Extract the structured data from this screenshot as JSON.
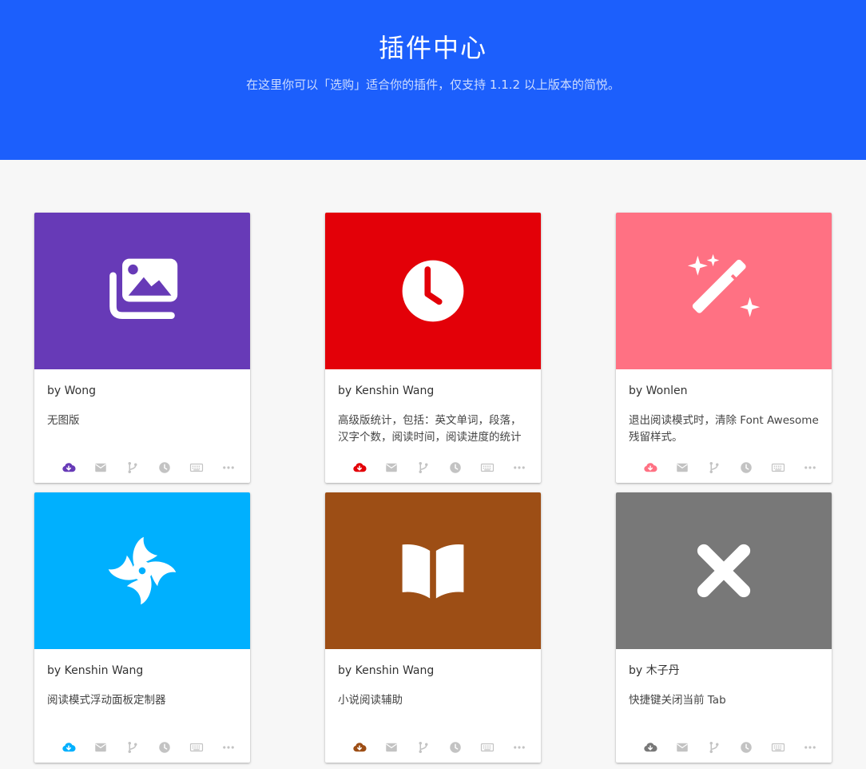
{
  "header": {
    "title": "插件中心",
    "subtitle": "在这里你可以「选购」适合你的插件，仅支持 1.1.2 以上版本的简悦。"
  },
  "colors": {
    "header_bg": "#1c5ffc",
    "action_icon": "#c3c3c3"
  },
  "action_icons": [
    "download-icon",
    "mail-icon",
    "branch-icon",
    "history-icon",
    "keyboard-icon",
    "more-icon"
  ],
  "plugins": [
    {
      "author": "by Wong",
      "description": "无图版",
      "color": "#673ab7",
      "icon": "images-icon"
    },
    {
      "author": "by Kenshin Wang",
      "description": "高级版统计，包括：英文单词，段落，汉字个数，阅读时间，阅读进度的统计",
      "color": "#e30008",
      "icon": "clock-icon"
    },
    {
      "author": "by Wonlen",
      "description": "退出阅读模式时，清除 Font Awesome 残留样式。",
      "color": "#ff7183",
      "icon": "magic-wand-icon"
    },
    {
      "author": "by Kenshin Wang",
      "description": "阅读模式浮动面板定制器",
      "color": "#00b0fe",
      "icon": "pinwheel-icon"
    },
    {
      "author": "by Kenshin Wang",
      "description": "小说阅读辅助",
      "color": "#9d4e15",
      "icon": "book-open-icon"
    },
    {
      "author": "by 木子丹",
      "description": "快捷键关闭当前 Tab",
      "color": "#787878",
      "icon": "close-icon"
    }
  ]
}
